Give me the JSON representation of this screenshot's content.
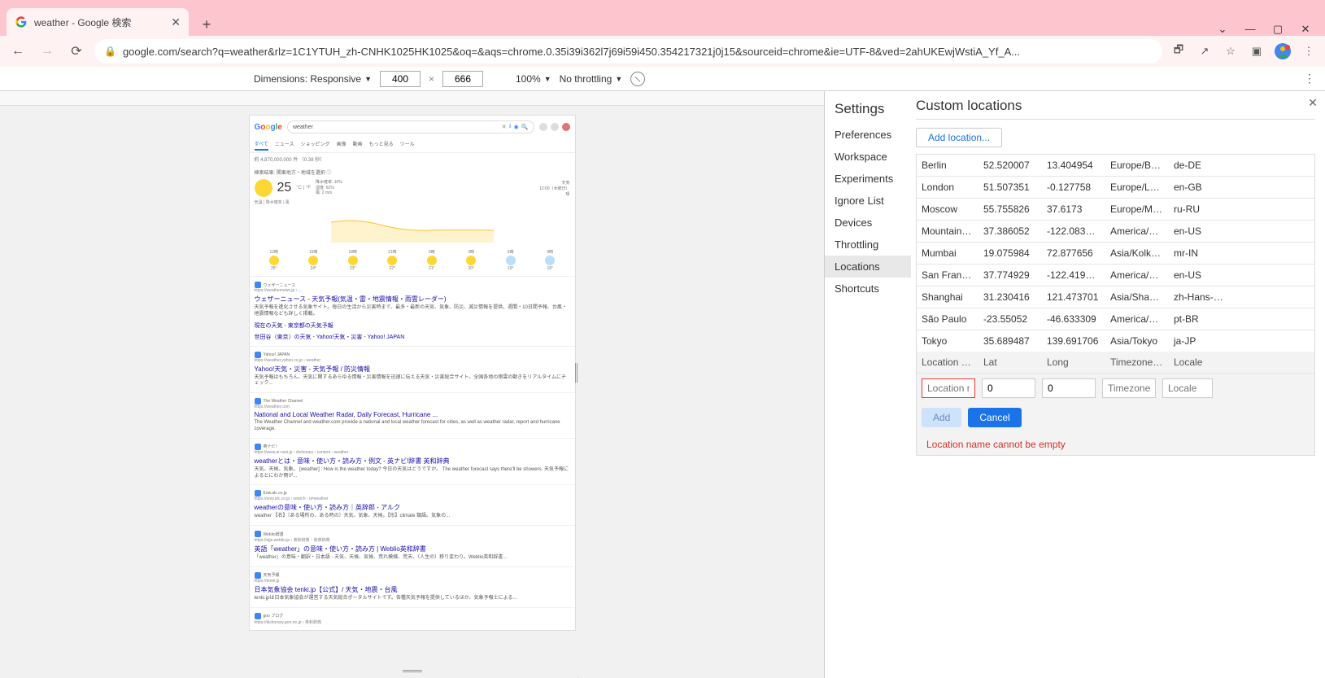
{
  "browser": {
    "tab_title": "weather - Google 検索",
    "url_display": "google.com/search?q=weather&rlz=1C1YTUH_zh-CNHK1025HK1025&oq=&aqs=chrome.0.35i39i362l7j69i59i450.354217321j0j15&sourceid=chrome&ie=UTF-8&ved=2ahUKEwjWstiA_Yf_A...",
    "url_host": "google.com"
  },
  "devbar": {
    "dim_label": "Dimensions: Responsive",
    "width": "400",
    "height": "666",
    "zoom": "100%",
    "throttling": "No throttling"
  },
  "settings": {
    "title": "Settings",
    "items": [
      "Preferences",
      "Workspace",
      "Experiments",
      "Ignore List",
      "Devices",
      "Throttling",
      "Locations",
      "Shortcuts"
    ],
    "selected": "Locations"
  },
  "locations_panel": {
    "title": "Custom locations",
    "add_button": "Add location...",
    "headers": {
      "name": "Location na...",
      "lat": "Lat",
      "lon": "Long",
      "tz": "Timezone ID",
      "locale": "Locale"
    },
    "rows": [
      {
        "name": "Berlin",
        "lat": "52.520007",
        "lon": "13.404954",
        "tz": "Europe/Berlin",
        "locale": "de-DE"
      },
      {
        "name": "London",
        "lat": "51.507351",
        "lon": "-0.127758",
        "tz": "Europe/Lon...",
        "locale": "en-GB"
      },
      {
        "name": "Moscow",
        "lat": "55.755826",
        "lon": "37.6173",
        "tz": "Europe/Mo...",
        "locale": "ru-RU"
      },
      {
        "name": "Mountain V...",
        "lat": "37.386052",
        "lon": "-122.083851",
        "tz": "America/Lo...",
        "locale": "en-US"
      },
      {
        "name": "Mumbai",
        "lat": "19.075984",
        "lon": "72.877656",
        "tz": "Asia/Kolkata",
        "locale": "mr-IN"
      },
      {
        "name": "San Francisco",
        "lat": "37.774929",
        "lon": "-122.419416",
        "tz": "America/Lo...",
        "locale": "en-US"
      },
      {
        "name": "Shanghai",
        "lat": "31.230416",
        "lon": "121.473701",
        "tz": "Asia/Shang...",
        "locale": "zh-Hans-CN"
      },
      {
        "name": "São Paulo",
        "lat": "-23.55052",
        "lon": "-46.633309",
        "tz": "America/Sa...",
        "locale": "pt-BR"
      },
      {
        "name": "Tokyo",
        "lat": "35.689487",
        "lon": "139.691706",
        "tz": "Asia/Tokyo",
        "locale": "ja-JP"
      }
    ],
    "form": {
      "name_ph": "Location na",
      "lat_val": "0",
      "lon_val": "0",
      "tz_ph": "Timezone I",
      "locale_ph": "Locale",
      "add": "Add",
      "cancel": "Cancel"
    },
    "error": "Location name cannot be empty"
  },
  "page": {
    "query": "weather",
    "tabs": [
      "すべて",
      "ニュース",
      "ショッピング",
      "画像",
      "動画",
      "もっと見る",
      "ツール"
    ],
    "stats": "約 4,870,000,000 件 （0.38 秒）",
    "weather": {
      "loc_line": "検索結果: 関東地方・地域を選択 ⓘ",
      "temp": "25",
      "unit": "°C | °F",
      "det1": "降水確率: 10%",
      "det2": "湿度: 62%",
      "det3": "風: 2 m/s",
      "side_t": "天気",
      "side_d": "12:00（木曜日）",
      "side_c": "晴",
      "sub": "気温 | 降水確率 | 風"
    },
    "results": [
      {
        "src": "ウェザーニュース",
        "url": "https://weathernews.jp › ...",
        "title": "ウェザーニュース - 天気予報(気温・雷・地震情報・雨雲レーダー)",
        "snip": "天気予報を進化させる気象サイト。毎日の生活から災害時まで、最多・最新の天気、気象、防災、減災情報を提供。週間・10日間予報、台風・地震情報なども詳しく掲載。",
        "sub": "現在の天気 - 東京都の天気予報",
        "sub2": "世田谷（東京）の天気 - Yahoo!天気・災害 - Yahoo! JAPAN"
      },
      {
        "src": "Yahoo! JAPAN",
        "url": "https://weather.yahoo.co.jp › weather",
        "title": "Yahoo!天気・災害 - 天気予報 / 防災情報",
        "snip": "天気予報はもちろん、天気に関するあらゆる情報・災害情報を迅速に伝える天気・災害総合サイト。全国各地の雨雲の動きをリアルタイムにチェック..."
      },
      {
        "src": "The Weather Channel",
        "url": "https://weather.com",
        "title": "National and Local Weather Radar, Daily Forecast, Hurricane ...",
        "snip": "The Weather Channel and weather.com provide a national and local weather forecast for cities, as well as weather radar, report and hurricane coverage."
      },
      {
        "src": "英ナビ！",
        "url": "https://www.ei-navi.jp › dictionary › content › weather",
        "title": "weatherとは・意味・使い方・読み方・例文 - 英ナビ!辞書 英和辞典",
        "snip": "天気、天候、気象。 [weather] : How is the weather today?  今日の天気はどうですか。 The weather forecast says there'll be showers. 天気予報によるとにわか雨が..."
      },
      {
        "src": "Eow.alc.co.jp",
        "url": "https://eow.alc.co.jp › search › q=weather",
        "title": "weatherの意味・使い方・読み方｜英辞郎 - アルク",
        "snip": "weather 【名】〔ある場所の、ある時の〕天気、気象、天候。【形】climate 類語。気象の..."
      },
      {
        "src": "Weblio辞書",
        "url": "https://ejje.weblio.jp › 英和辞典・和英辞典",
        "title": "英語「weather」の意味・使い方・読み方 | Weblio英和辞書",
        "snip": "「weather」の意味・翻訳・日本語 - 天気、天候、気候、荒れ模様、荒天、（人生の）移り変わり。Weblio英和辞書..."
      },
      {
        "src": "天気予報",
        "url": "https://tenki.jp",
        "title": "日本気象協会 tenki.jp【公式】/ 天気・地震・台風",
        "snip": "tenki.jpは日本気象協会が運営する天気総合ポータルサイトです。各種天気予報を提供しているほか、気象予報士による..."
      },
      {
        "src": "goo ブログ",
        "url": "https://dictionary.goo.ne.jp › 英和辞典",
        "title": "",
        "snip": ""
      }
    ]
  }
}
